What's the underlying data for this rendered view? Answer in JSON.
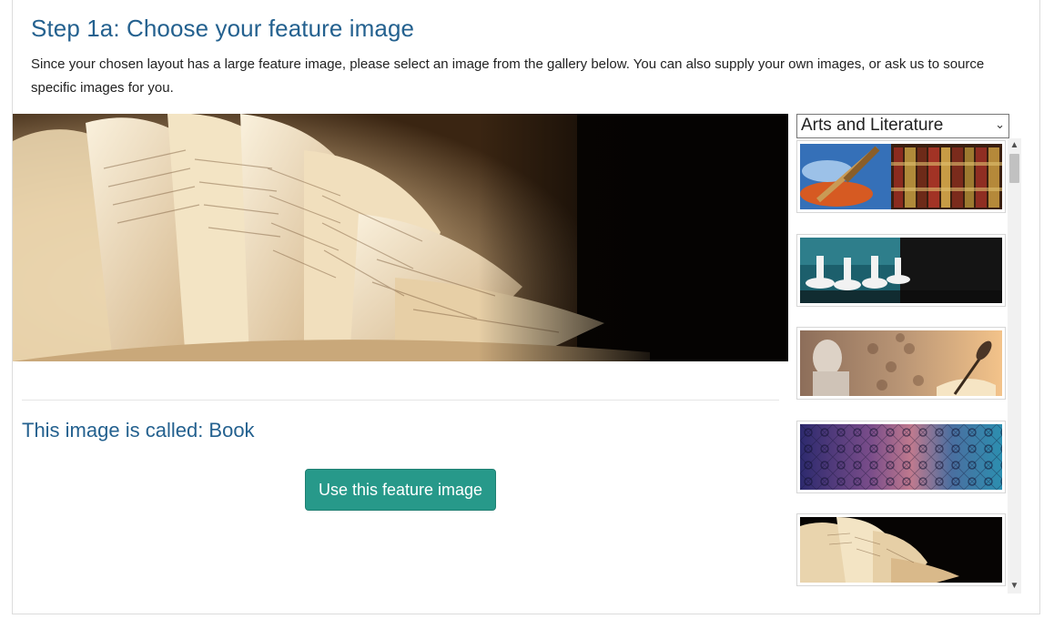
{
  "page": {
    "title": "Step 1a: Choose your feature image",
    "intro": "Since your chosen layout has a large feature image, please select an image from the gallery below. You can also supply your own images, or ask us to source specific images for you."
  },
  "feature": {
    "caption": "This image is called: Book",
    "use_button": "Use this feature image"
  },
  "gallery": {
    "category": "Arts and Literature",
    "thumbnails": [
      {
        "subject": "paintbrush and books"
      },
      {
        "subject": "ballet dancers"
      },
      {
        "subject": "statue and quill"
      },
      {
        "subject": "damask pattern"
      },
      {
        "subject": "book pages"
      }
    ]
  },
  "colors": {
    "heading": "#24618f",
    "button": "#27998a"
  }
}
